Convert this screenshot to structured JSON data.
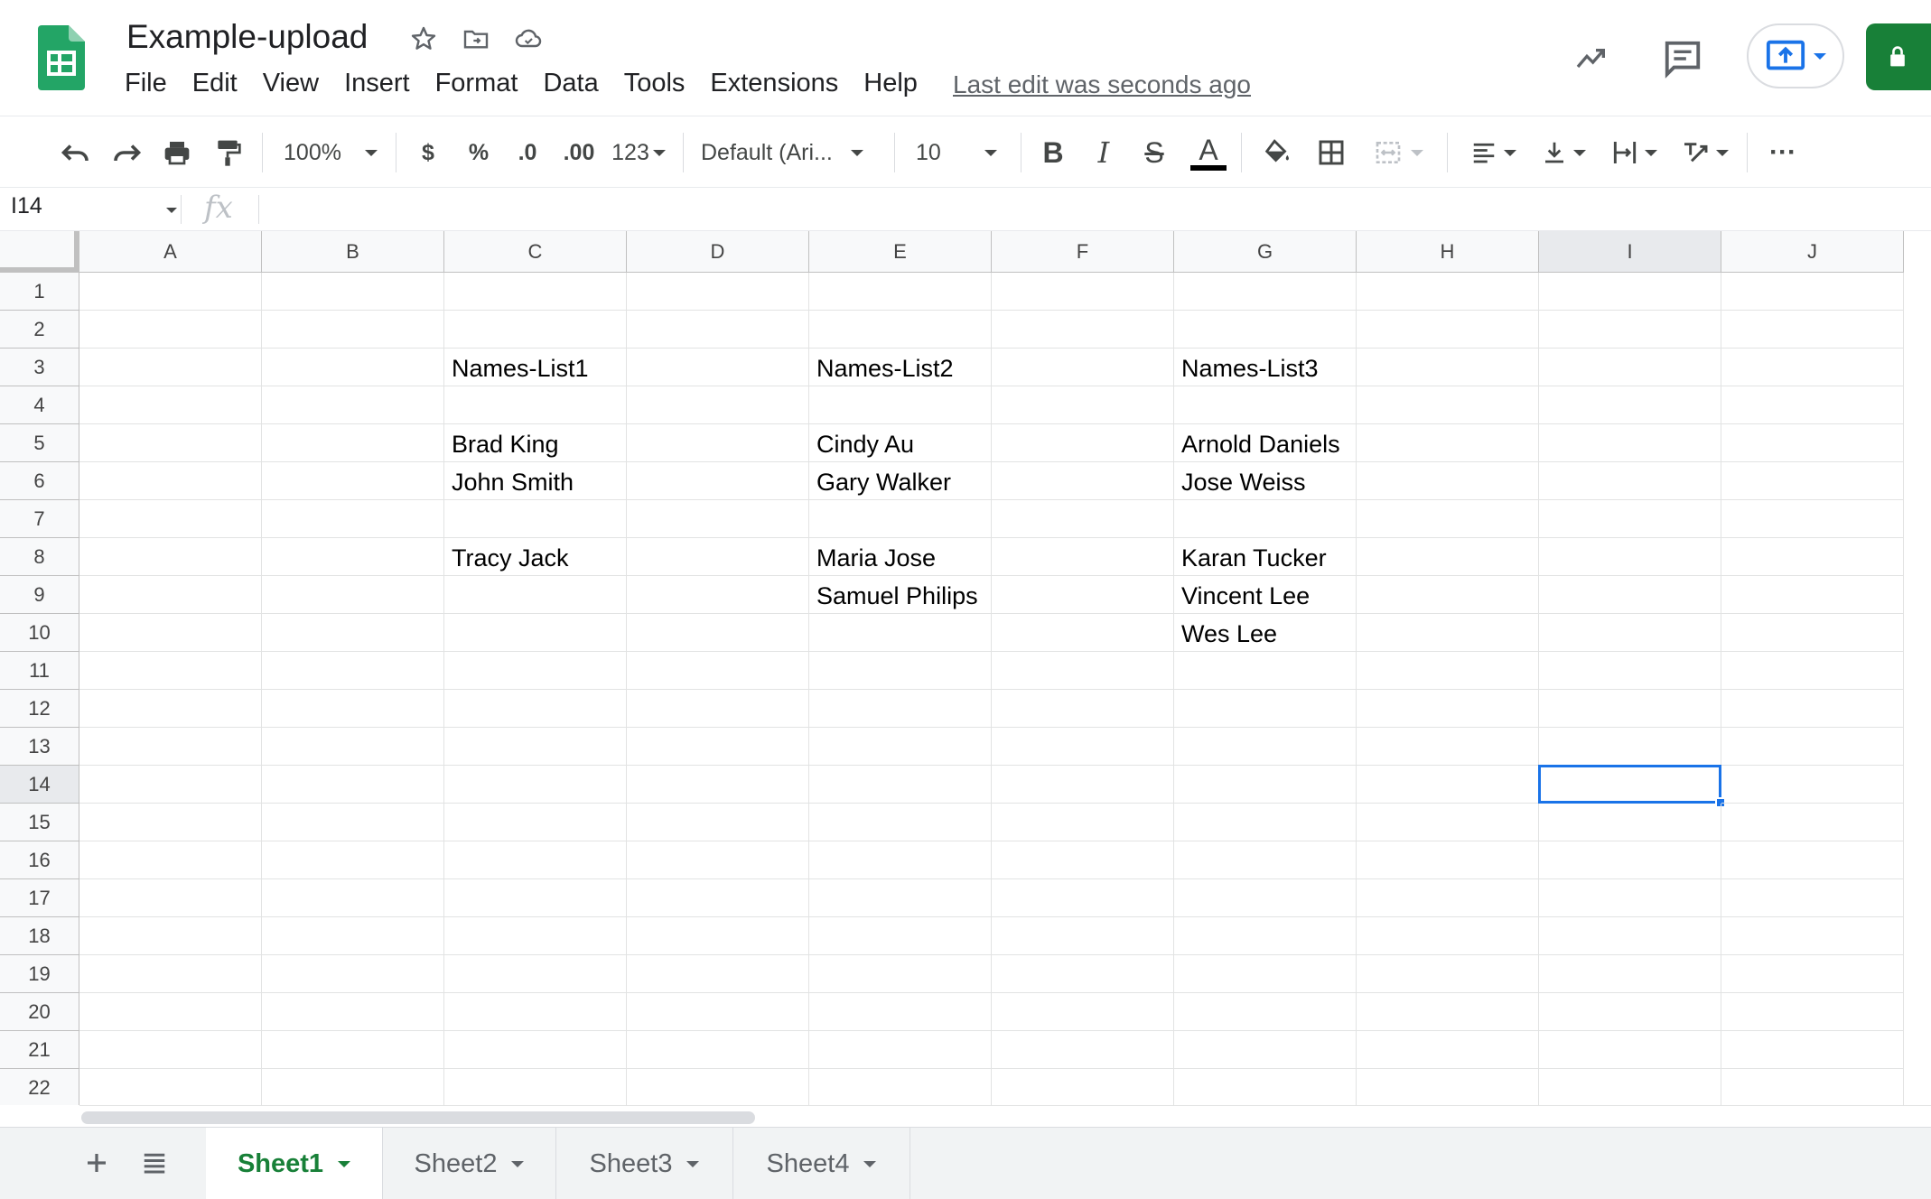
{
  "doc": {
    "title": "Example-upload",
    "last_edit": "Last edit was seconds ago"
  },
  "menu": [
    "File",
    "Edit",
    "View",
    "Insert",
    "Format",
    "Data",
    "Tools",
    "Extensions",
    "Help"
  ],
  "toolbar": {
    "zoom": "100%",
    "currency": "$",
    "percent": "%",
    "decrease_decimal": ".0",
    "increase_decimal": ".00",
    "more_formats": "123",
    "font": "Default (Ari...",
    "font_size": "10",
    "bold": "B",
    "italic": "I",
    "strike": "S",
    "text_color": "A",
    "more": "···"
  },
  "formula_bar": {
    "cell_ref": "I14",
    "fx": "fx",
    "value": ""
  },
  "grid": {
    "columns": [
      "A",
      "B",
      "C",
      "D",
      "E",
      "F",
      "G",
      "H",
      "I",
      "J"
    ],
    "rows": [
      "1",
      "2",
      "3",
      "4",
      "5",
      "6",
      "7",
      "8",
      "9",
      "10",
      "11",
      "12",
      "13",
      "14",
      "15",
      "16",
      "17",
      "18",
      "19",
      "20",
      "21",
      "22"
    ],
    "selected_cell": "I14",
    "cells": {
      "C3": "Names-List1",
      "E3": "Names-List2",
      "G3": "Names-List3",
      "C5": "Brad King",
      "E5": "Cindy Au",
      "G5": "Arnold Daniels",
      "C6": "John Smith",
      "E6": "Gary Walker",
      "G6": "Jose Weiss",
      "C8": "Tracy Jack",
      "E8": "Maria Jose",
      "G8": "Karan Tucker",
      "E9": "Samuel Philips",
      "G9": "Vincent Lee",
      "G10": "Wes Lee"
    }
  },
  "sheets": [
    {
      "name": "Sheet1",
      "active": true
    },
    {
      "name": "Sheet2",
      "active": false
    },
    {
      "name": "Sheet3",
      "active": false
    },
    {
      "name": "Sheet4",
      "active": false
    }
  ],
  "colors": {
    "brand_green": "#188038",
    "selection_blue": "#1a73e8"
  }
}
